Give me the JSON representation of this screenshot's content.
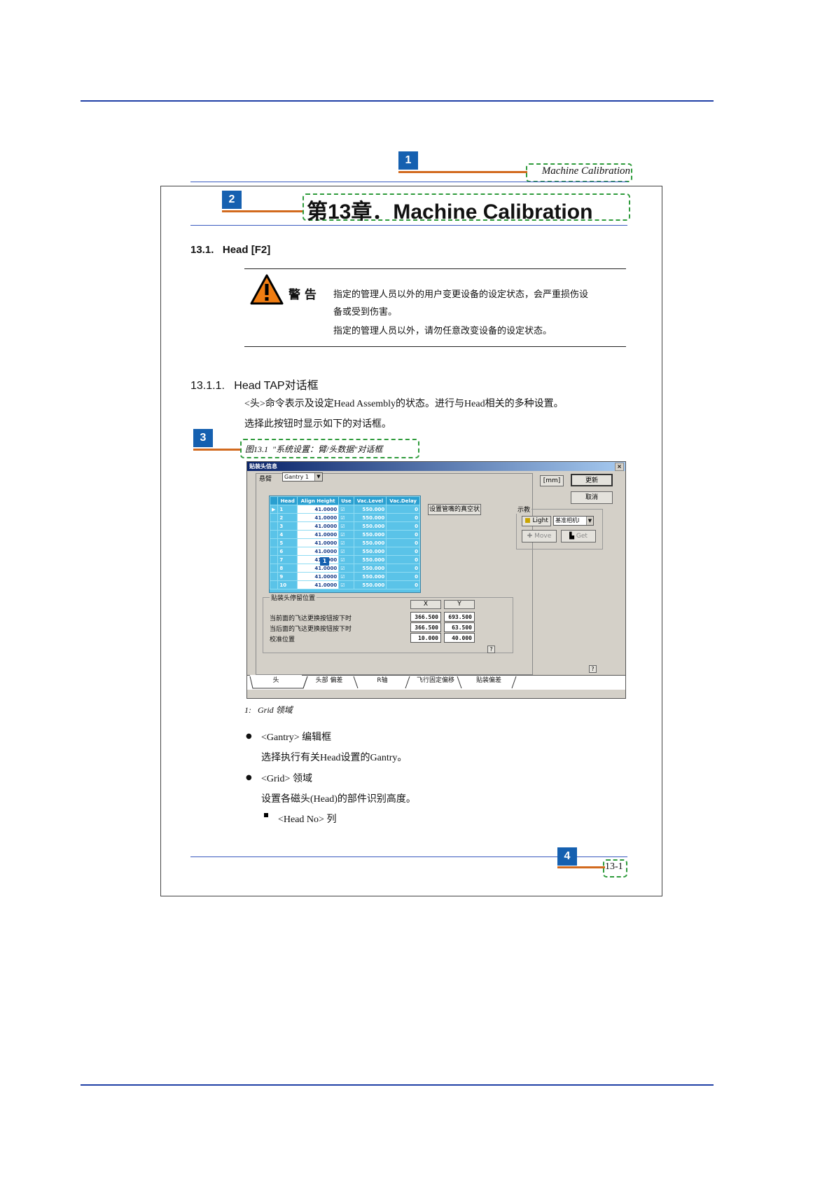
{
  "callouts": [
    "1",
    "2",
    "3",
    "4"
  ],
  "header_running_title": "Machine Calibration",
  "chapter_title": "第13章．Machine Calibration",
  "section_13_1": "13.1.   Head [F2]",
  "warning": {
    "label": "警 告",
    "line1": "指定的管理人员以外的用户变更设备的设定状态，会严重损伤设",
    "line2": "备或受到伤害。",
    "line3": "指定的管理人员以外，请勿任意改变设备的设定状态。"
  },
  "section_13_1_1": "13.1.1.   Head TAP对话框",
  "intro1": "<头>命令表示及设定Head Assembly的状态。进行与Head相关的多种设置。",
  "intro2": "选择此按钮时显示如下的对话框。",
  "figure_caption": "图13.1  \"系统设置：臂/头数据\"对话框",
  "dialog": {
    "title": "贴装头信息",
    "close": "×",
    "gantry_label": "悬臂",
    "gantry_value": "Gantry 1",
    "unit": "[mm]",
    "update": "更新",
    "cancel": "取消",
    "vacuum_btn": "设置管嘴的真空状",
    "teach_label": "示教",
    "light": "Light",
    "camera_select": "基准相机I",
    "move": "Move",
    "get": "Get",
    "grid_columns": [
      "",
      "Head",
      "Align Height",
      "Use",
      "Vac.Level",
      "Vac.Delay"
    ],
    "grid_rows": [
      [
        "▶",
        "1",
        "41.0000",
        "☑",
        "550.000",
        "0"
      ],
      [
        "",
        "2",
        "41.0000",
        "☑",
        "550.000",
        "0"
      ],
      [
        "",
        "3",
        "41.0000",
        "☑",
        "550.000",
        "0"
      ],
      [
        "",
        "4",
        "41.0000",
        "☑",
        "550.000",
        "0"
      ],
      [
        "",
        "5",
        "41.0000",
        "☑",
        "550.000",
        "0"
      ],
      [
        "",
        "6",
        "41.0000",
        "☑",
        "550.000",
        "0"
      ],
      [
        "",
        "7",
        "41.0000",
        "☑",
        "550.000",
        "0"
      ],
      [
        "",
        "8",
        "41.0000",
        "☑",
        "550.000",
        "0"
      ],
      [
        "",
        "9",
        "41.0000",
        "☑",
        "550.000",
        "0"
      ],
      [
        "",
        "10",
        "41.0000",
        "☑",
        "550.000",
        "0"
      ]
    ],
    "grid_marker": "1",
    "pos_group": "贴装头停留位置",
    "col_x": "X",
    "col_y": "Y",
    "pos_rows": [
      {
        "label": "当前面的飞达更换按钮按下时",
        "x": "366.500",
        "y": "693.500"
      },
      {
        "label": "当后面的飞达更换按钮按下时",
        "x": "366.500",
        "y": "63.500"
      },
      {
        "label": "校准位置",
        "x": "10.000",
        "y": "40.000"
      }
    ],
    "help": "?",
    "tabs": [
      "头",
      "头部 偏差",
      "R轴",
      "飞行固定偏移",
      "贴装偏差"
    ]
  },
  "figure_note": "1:   Grid 领域",
  "bullets": [
    {
      "title": "<Gantry> 编辑框",
      "desc": "选择执行有关Head设置的Gantry。"
    },
    {
      "title": "<Grid> 领域",
      "desc": "设置各磁头(Head)的部件识别高度。"
    }
  ],
  "sub_bullet": "<Head No> 列",
  "page_number": "13-1"
}
